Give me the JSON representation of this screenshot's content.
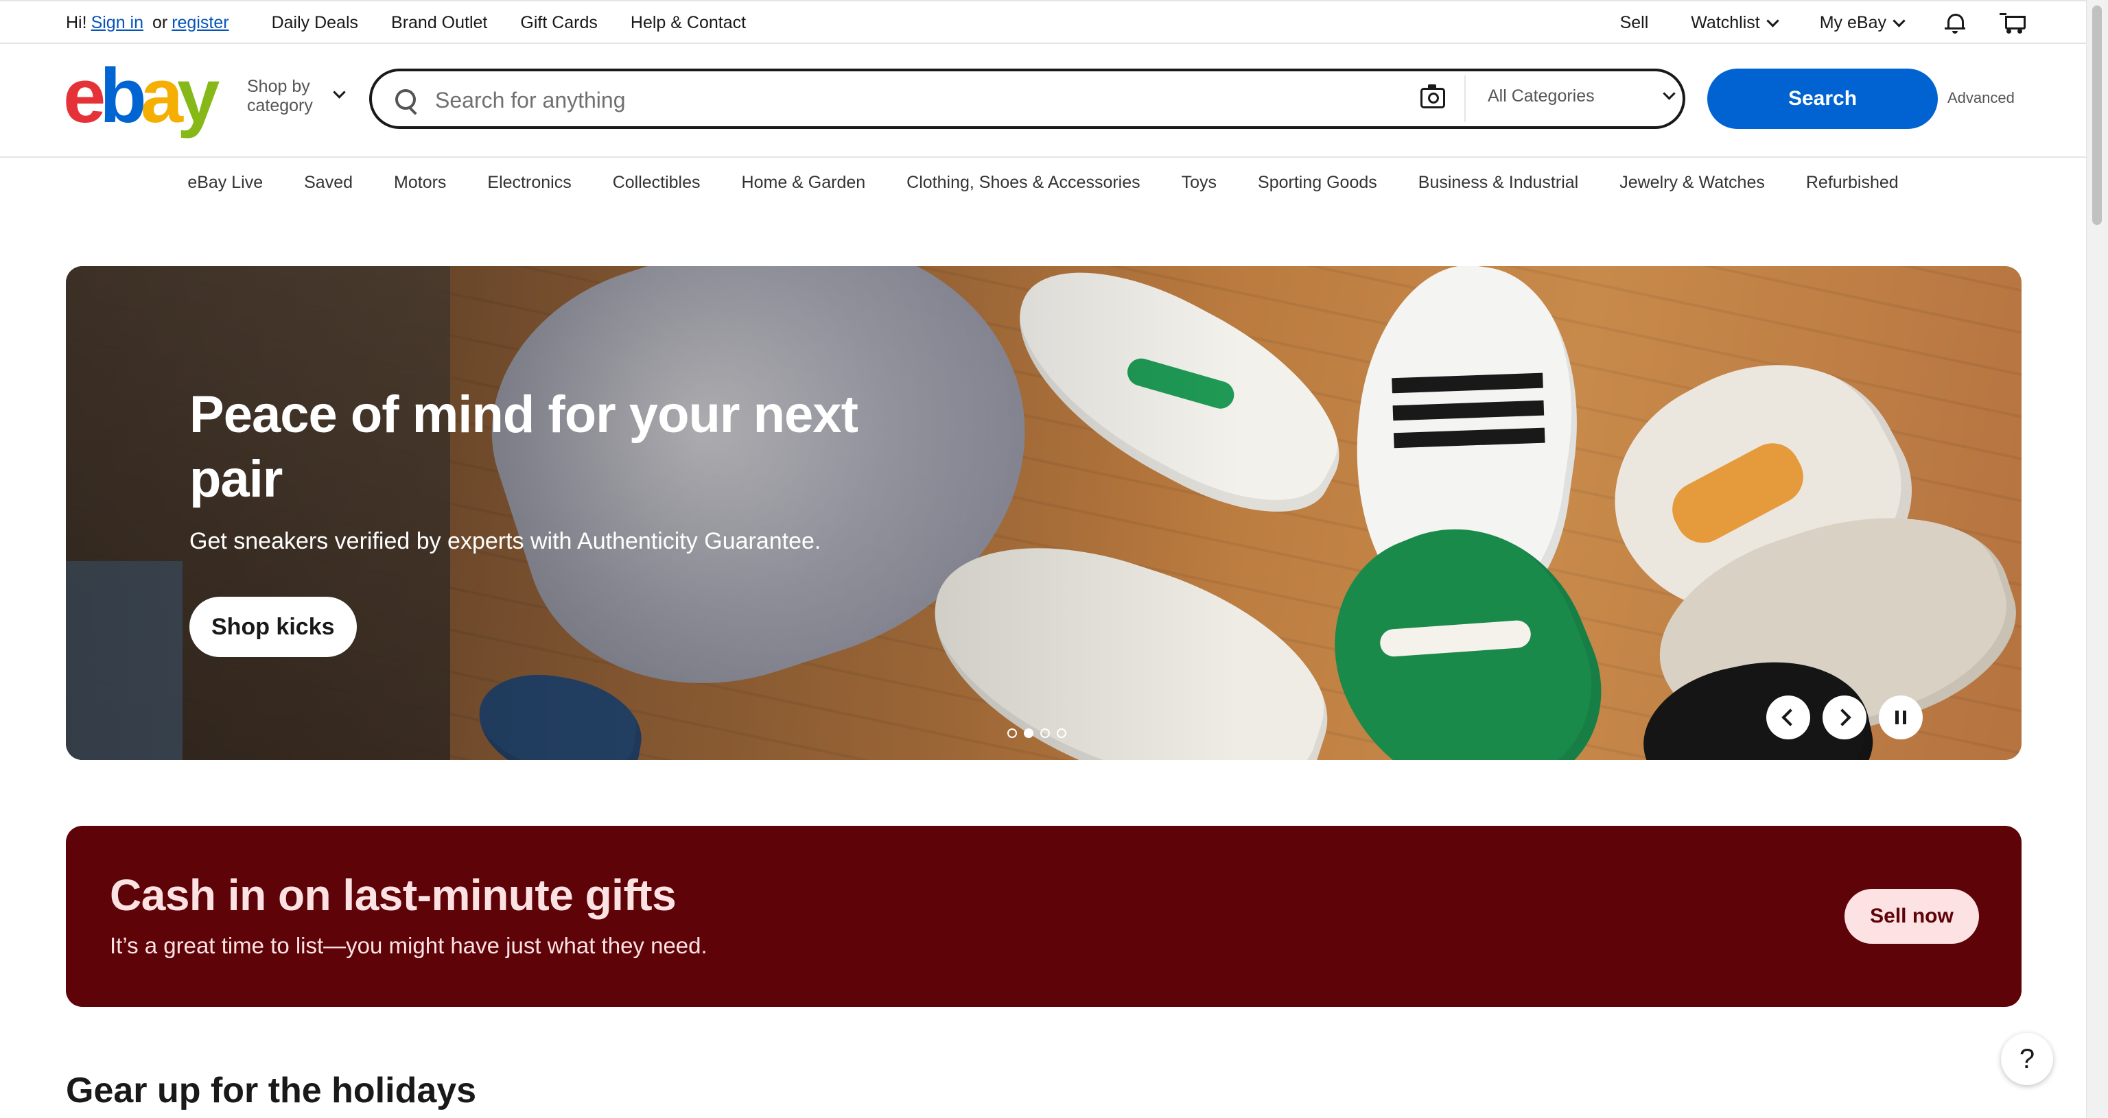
{
  "topbar": {
    "greeting_prefix": "Hi!",
    "sign_in": "Sign in",
    "or": "or",
    "register": "register",
    "links": [
      "Daily Deals",
      "Brand Outlet",
      "Gift Cards",
      "Help & Contact"
    ],
    "sell": "Sell",
    "watchlist": "Watchlist",
    "my_ebay": "My eBay",
    "notification_icon": "bell-icon",
    "cart_icon": "cart-icon"
  },
  "header": {
    "logo": {
      "e": "e",
      "b": "b",
      "a": "a",
      "y": "y"
    },
    "shop_by_line1": "Shop by",
    "shop_by_line2": "category",
    "search_placeholder": "Search for anything",
    "search_value": "",
    "category_selected": "All Categories",
    "search_button": "Search",
    "advanced": "Advanced"
  },
  "category_nav": [
    "eBay Live",
    "Saved",
    "Motors",
    "Electronics",
    "Collectibles",
    "Home & Garden",
    "Clothing, Shoes & Accessories",
    "Toys",
    "Sporting Goods",
    "Business & Industrial",
    "Jewelry & Watches",
    "Refurbished"
  ],
  "hero": {
    "title": "Peace of mind for your next pair",
    "subtitle": "Get sneakers verified by experts with Authenticity Guarantee.",
    "cta": "Shop kicks",
    "slides_count": 4,
    "active_slide": 2
  },
  "promo": {
    "title": "Cash in on last-minute gifts",
    "subtitle": "It’s a great time to list—you might have just what they need.",
    "cta": "Sell now",
    "bg_color": "#5e0307",
    "text_color": "#fde2e4"
  },
  "section": {
    "title": "Gear up for the holidays"
  },
  "help": {
    "label": "?"
  },
  "colors": {
    "accent": "#0063d1",
    "link": "#0654ba"
  }
}
